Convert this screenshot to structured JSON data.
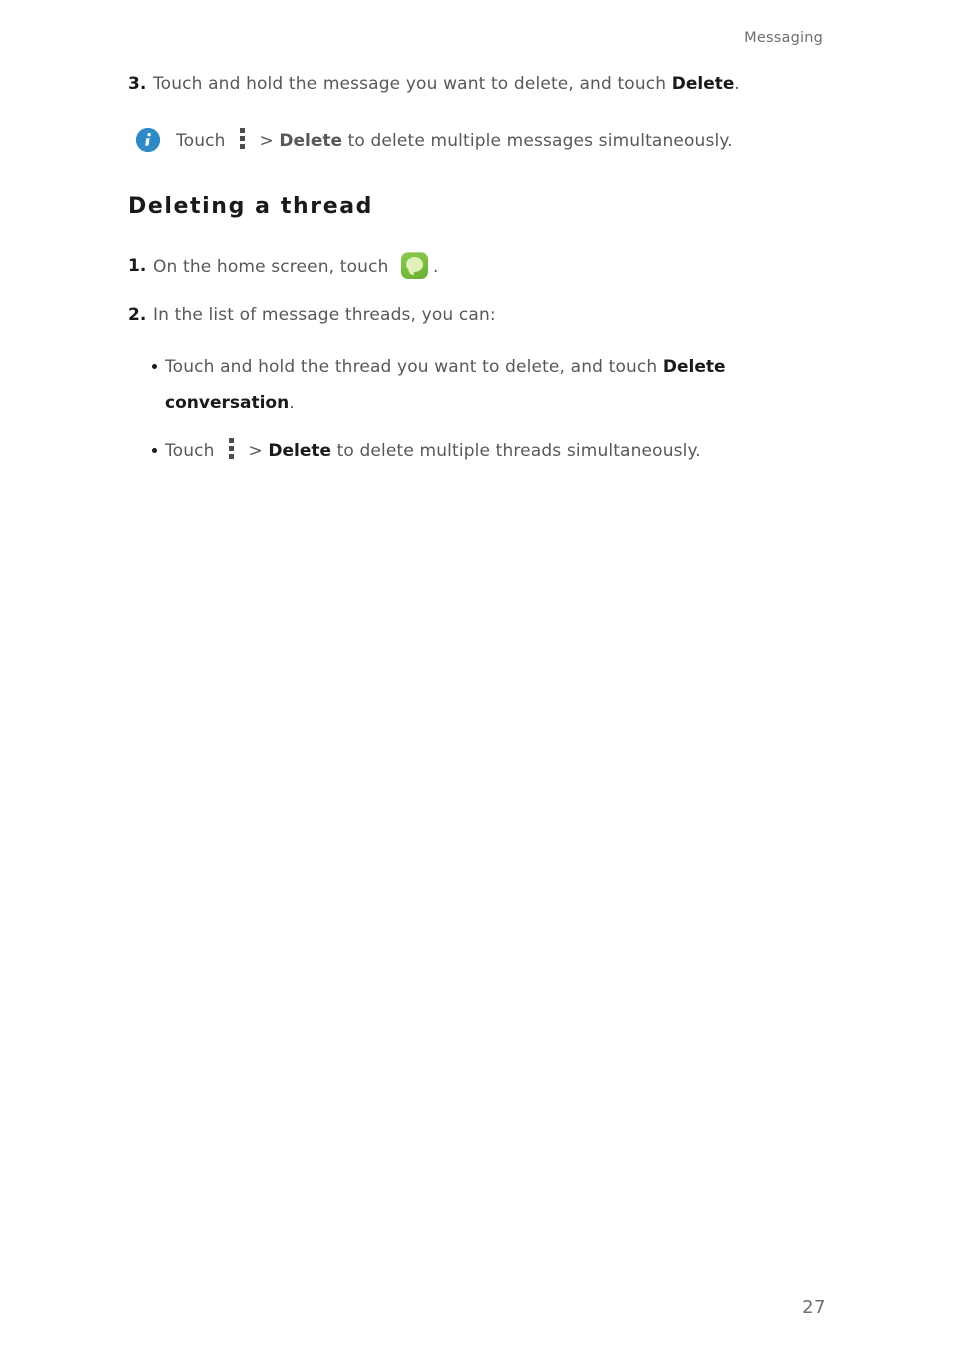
{
  "document": {
    "running_header": "Messaging",
    "page_number": "27"
  },
  "colors": {
    "note_icon_blue": "#2d8ac4",
    "app_icon_green": "#79bd3e",
    "app_icon_bubble": "#dff0b9",
    "body_text": "#58585a",
    "bold_text": "#1a1a1a",
    "dots_icon": "#4d4d4f"
  },
  "steps_continued": [
    {
      "number": "3.",
      "text_before": "Touch and hold the message you want to delete, and touch ",
      "bold": "Delete",
      "text_after": "."
    }
  ],
  "note": {
    "icon": "info-icon",
    "text_before": "Touch",
    "menu_icon": "overflow-menu-icon",
    "separator": ">",
    "bold": "Delete",
    "text_after": " to delete multiple messages simultaneously."
  },
  "section": {
    "heading": "Deleting a thread",
    "steps": [
      {
        "number": "1.",
        "text_before": "On the home screen, touch ",
        "icon": "messaging-app-icon",
        "text_after": "."
      },
      {
        "number": "2.",
        "text_before": "In the list of message threads, you can:",
        "text_after": ""
      }
    ],
    "bullets": [
      {
        "text_before": "Touch and hold the thread you want to delete, and touch ",
        "bold": "Delete conversation",
        "text_after": "."
      },
      {
        "text_before": "Touch",
        "menu_icon": "overflow-menu-icon",
        "separator": ">",
        "bold": "Delete",
        "text_after": " to delete multiple threads simultaneously."
      }
    ]
  }
}
